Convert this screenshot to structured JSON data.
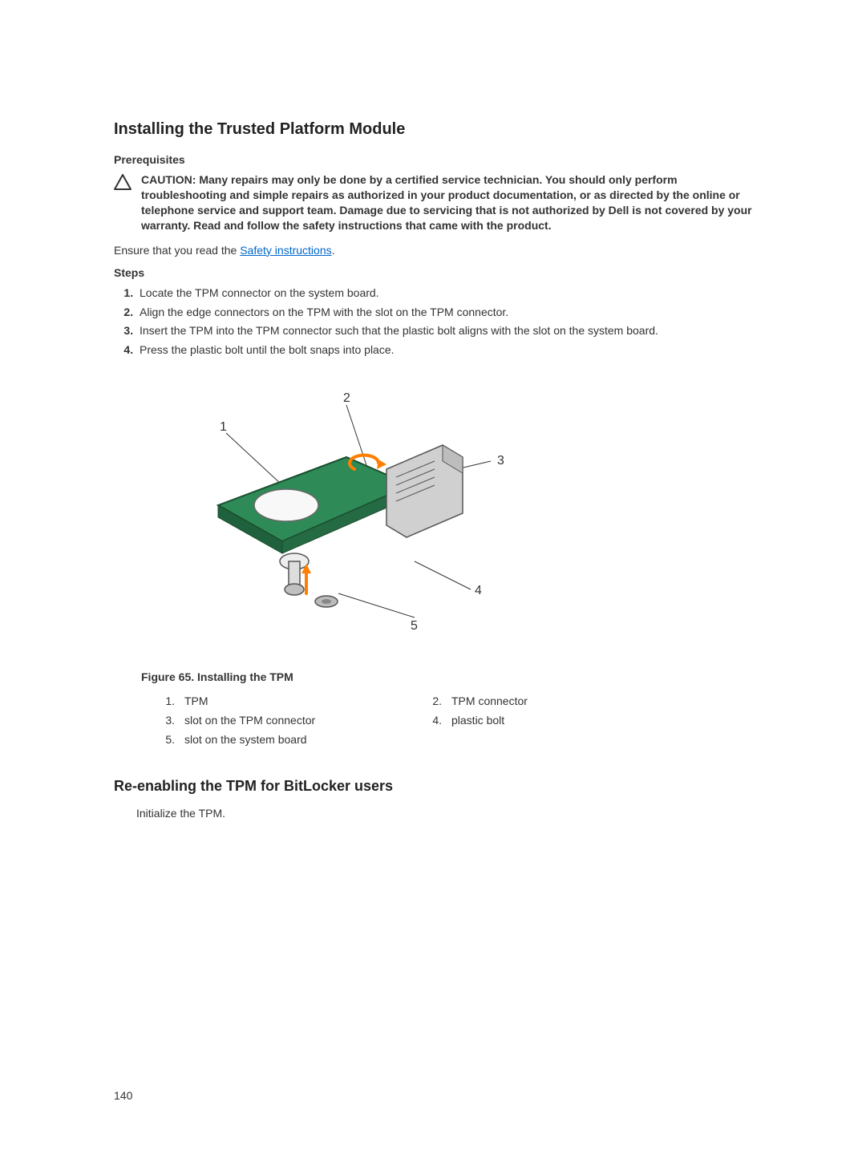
{
  "section1": {
    "title": "Installing the Trusted Platform Module",
    "prereq_label": "Prerequisites",
    "caution_text": "CAUTION: Many repairs may only be done by a certified service technician. You should only perform troubleshooting and simple repairs as authorized in your product documentation, or as directed by the online or telephone service and support team. Damage due to servicing that is not authorized by Dell is not covered by your warranty. Read and follow the safety instructions that came with the product.",
    "ensure_prefix": "Ensure that you read the ",
    "ensure_link": "Safety instructions",
    "ensure_suffix": ".",
    "steps_label": "Steps",
    "steps": [
      "Locate the TPM connector on the system board.",
      "Align the edge connectors on the TPM with the slot on the TPM connector.",
      "Insert the TPM into the TPM connector such that the plastic bolt aligns with the slot on the system board.",
      "Press the plastic bolt until the bolt snaps into place."
    ],
    "figure": {
      "caption": "Figure 65. Installing the TPM",
      "callouts": {
        "1": "1",
        "2": "2",
        "3": "3",
        "4": "4",
        "5": "5"
      },
      "legend": {
        "n1": "1.",
        "t1": "TPM",
        "n2": "2.",
        "t2": "TPM connector",
        "n3": "3.",
        "t3": "slot on the TPM connector",
        "n4": "4.",
        "t4": "plastic bolt",
        "n5": "5.",
        "t5": "slot on the system board"
      }
    }
  },
  "section2": {
    "title": "Re-enabling the TPM for BitLocker users",
    "body": "Initialize the TPM."
  },
  "page_number": "140"
}
